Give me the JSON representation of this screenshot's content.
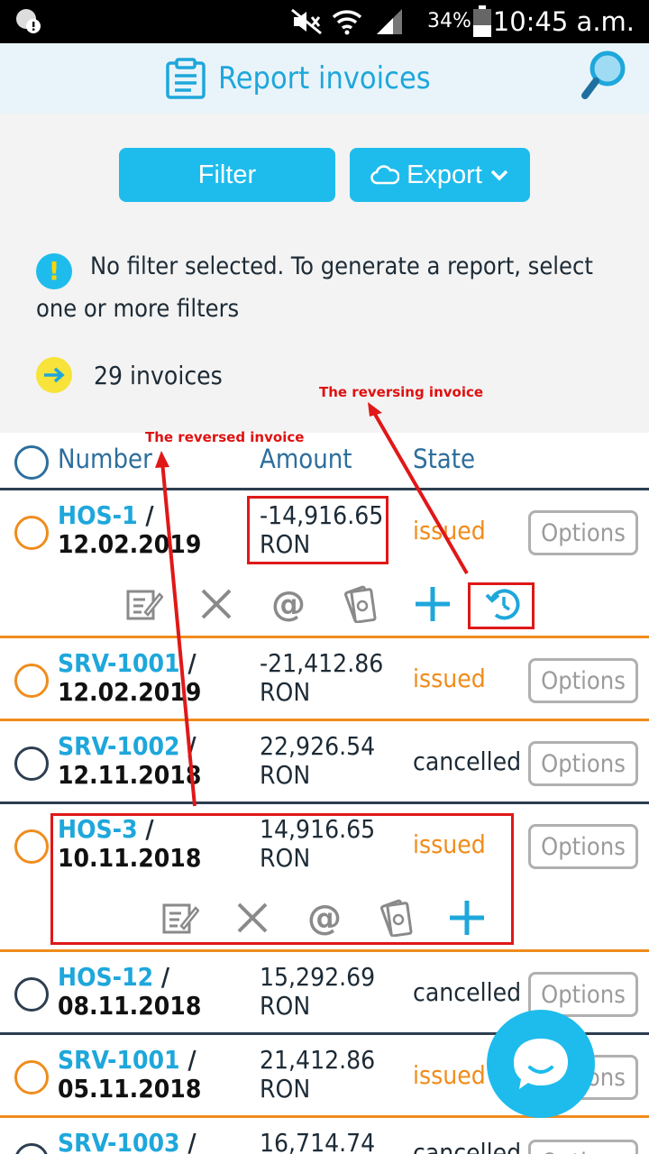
{
  "status_bar": {
    "battery": "34%",
    "time": "10:45 a.m."
  },
  "header": {
    "title": "Report invoices"
  },
  "panel": {
    "filter_label": "Filter",
    "export_label": "Export",
    "info_text": "No filter selected. To generate a report, select one or more filters",
    "invoice_count": "29 invoices"
  },
  "table": {
    "headers": {
      "number": "Number",
      "amount": "Amount",
      "state": "State"
    },
    "options_label": "Options",
    "rows": [
      {
        "code": "HOS-1",
        "date": "12.02.2019",
        "amount": "-14,916.65",
        "currency": "RON",
        "state": "issued"
      },
      {
        "code": "SRV-1001",
        "date": "12.02.2019",
        "amount": "-21,412.86",
        "currency": "RON",
        "state": "issued"
      },
      {
        "code": "SRV-1002",
        "date": "12.11.2018",
        "amount": "22,926.54",
        "currency": "RON",
        "state": "cancelled"
      },
      {
        "code": "HOS-3",
        "date": "10.11.2018",
        "amount": "14,916.65",
        "currency": "RON",
        "state": "issued"
      },
      {
        "code": "HOS-12",
        "date": "08.11.2018",
        "amount": "15,292.69",
        "currency": "RON",
        "state": "cancelled"
      },
      {
        "code": "SRV-1001",
        "date": "05.11.2018",
        "amount": "21,412.86",
        "currency": "RON",
        "state": "issued"
      },
      {
        "code": "SRV-1003",
        "date": "",
        "amount": "16,714.74",
        "currency": "",
        "state": "cancelled"
      }
    ]
  },
  "annotations": {
    "reversing": "The reversing invoice",
    "reversed": "The reversed invoice"
  },
  "colors": {
    "accent": "#1ebcec",
    "issued": "#f08c1c",
    "annotation": "#e01010"
  },
  "icons": [
    "alert-icon",
    "mute-icon",
    "wifi-icon",
    "signal-icon",
    "battery-icon",
    "clipboard-icon",
    "search-icon",
    "cloud-icon",
    "chevron-down-icon",
    "info-icon",
    "arrow-right-icon",
    "edit-icon",
    "cancel-icon",
    "email-icon",
    "payment-icon",
    "add-icon",
    "reverse-icon",
    "chat-icon"
  ]
}
